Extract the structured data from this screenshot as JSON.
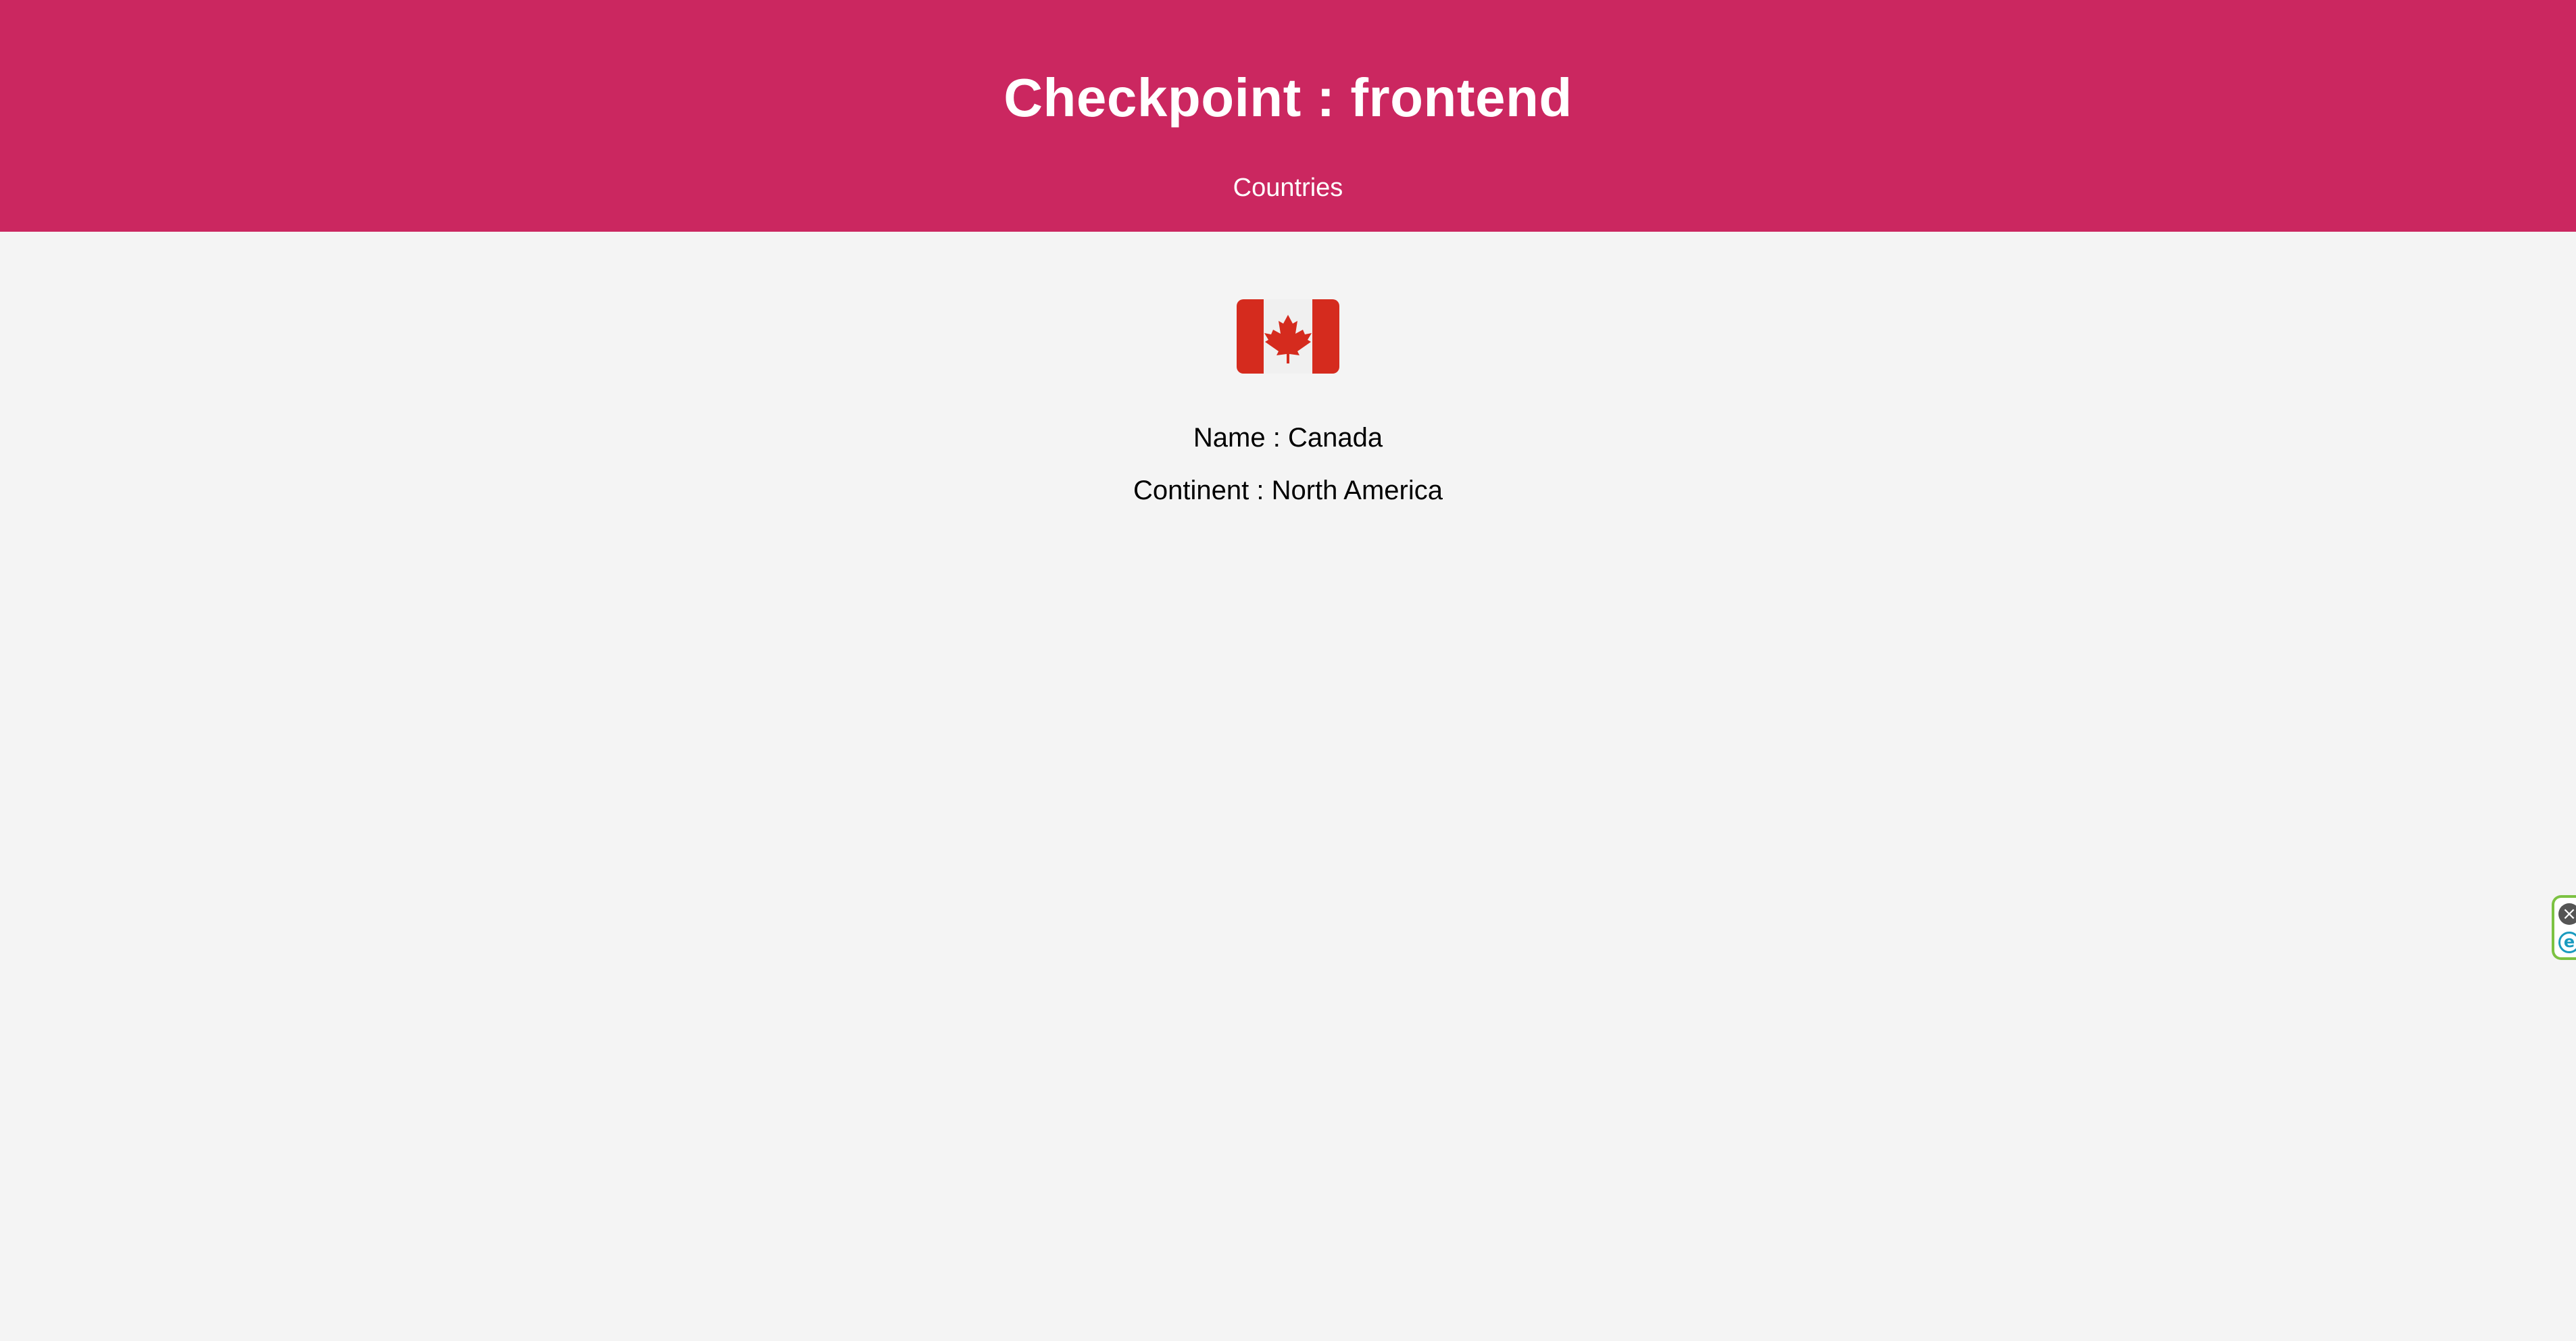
{
  "header": {
    "title": "Checkpoint : frontend",
    "nav_link": "Countries",
    "background_color": "#cb2760"
  },
  "country": {
    "flag_icon": "canada-flag-icon",
    "name_line": "Name : Canada",
    "continent_line": "Continent : North America"
  },
  "side_widget": {
    "close_icon": "close-icon",
    "logo_icon": "extension-logo-icon",
    "border_color": "#7cc242"
  }
}
